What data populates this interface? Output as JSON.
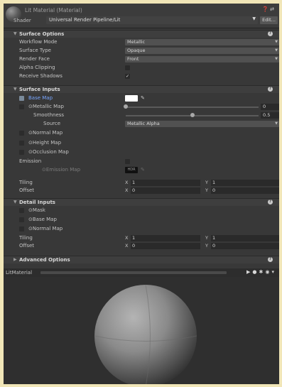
{
  "header": {
    "title": "Lit Material (Material)",
    "shader_label": "Shader",
    "shader_value": "Universal Render Pipeline/Lit",
    "edit_label": "Edit..."
  },
  "surface_options": {
    "title": "Surface Options",
    "rows": [
      {
        "label": "Workflow Mode",
        "value": "Metallic"
      },
      {
        "label": "Surface Type",
        "value": "Opaque"
      },
      {
        "label": "Render Face",
        "value": "Front"
      },
      {
        "label": "Alpha Clipping",
        "checked": false
      },
      {
        "label": "Receive Shadows",
        "checked": true
      }
    ]
  },
  "surface_inputs": {
    "title": "Surface Inputs",
    "base_map": "Base Map",
    "metallic_map": "Metallic Map",
    "metallic_value": "0",
    "metallic_fraction": 0,
    "smoothness": "Smoothness",
    "smoothness_value": "0.5",
    "smoothness_fraction": 0.5,
    "source": "Source",
    "source_value": "Metallic Alpha",
    "normal_map": "Normal Map",
    "height_map": "Height Map",
    "occlusion_map": "Occlusion Map",
    "emission": "Emission",
    "emission_map": "Emission Map",
    "hdr_label": "HDR",
    "tiling": "Tiling",
    "offset": "Offset",
    "tiling_x": "1",
    "tiling_y": "1",
    "offset_x": "0",
    "offset_y": "0"
  },
  "detail_inputs": {
    "title": "Detail Inputs",
    "mask": "Mask",
    "base_map": "Base Map",
    "normal_map": "Normal Map",
    "tiling": "Tiling",
    "offset": "Offset",
    "tiling_x": "1",
    "tiling_y": "1",
    "offset_x": "0",
    "offset_y": "0"
  },
  "advanced_options": {
    "title": "Advanced Options"
  },
  "preview": {
    "name": "LitMaterial"
  },
  "axis": {
    "x": "X",
    "y": "Y"
  },
  "icons": {
    "help": "help-icon",
    "picker": "eyedropper-icon",
    "dropdown": "chevron-down-icon"
  },
  "colors": {
    "panel": "#383838",
    "highlight": "#78a6ff",
    "base_color": "#ffffff"
  }
}
